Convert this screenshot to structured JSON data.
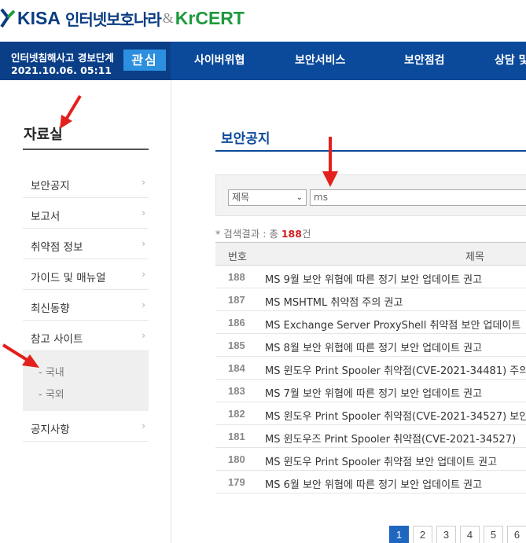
{
  "header": {
    "logo_kisa": "KISA",
    "logo_brand": "인터넷보호나라",
    "logo_amp": "&",
    "logo_krcert": "KrCERT"
  },
  "alert": {
    "title": "인터넷침해사고 경보단계",
    "date": "2021.10.06. 05:11",
    "level": "관심"
  },
  "nav": {
    "items": [
      "사이버위협",
      "보안서비스",
      "보안점검",
      "상담 및"
    ]
  },
  "sidebar": {
    "title": "자료실",
    "items": [
      {
        "label": "보안공지"
      },
      {
        "label": "보고서"
      },
      {
        "label": "취약점 정보"
      },
      {
        "label": "가이드 및 매뉴얼"
      },
      {
        "label": "최신동향"
      },
      {
        "label": "참고 사이트"
      }
    ],
    "sub_items": [
      "- 국내",
      "- 국외"
    ],
    "last_item": {
      "label": "공지사항"
    }
  },
  "main": {
    "title": "보안공지",
    "search": {
      "select_value": "제목",
      "input_value": "ms"
    },
    "result": {
      "prefix": "* 검색결과 : 총 ",
      "count": "188",
      "suffix": "건"
    },
    "table": {
      "columns": [
        "번호",
        "제목"
      ],
      "rows": [
        {
          "no": "188",
          "title": "MS 9월 보안 위협에 따른 정기 보안 업데이트 권고"
        },
        {
          "no": "187",
          "title": "MS MSHTML 취약점 주의 권고"
        },
        {
          "no": "186",
          "title": "MS Exchange Server ProxyShell 취약점 보안 업데이트"
        },
        {
          "no": "185",
          "title": "MS 8월 보안 위협에 따른 정기 보안 업데이트 권고"
        },
        {
          "no": "184",
          "title": "MS 윈도우 Print Spooler 취약점(CVE-2021-34481) 주의"
        },
        {
          "no": "183",
          "title": "MS 7월 보안 위협에 따른 정기 보안 업데이트 권고"
        },
        {
          "no": "182",
          "title": "MS 윈도우 Print Spooler 취약점(CVE-2021-34527) 보안"
        },
        {
          "no": "181",
          "title": "MS 윈도우즈 Print Spooler 취약점(CVE-2021-34527)"
        },
        {
          "no": "180",
          "title": "MS 윈도우 Print Spooler 취약점 보안 업데이트 권고"
        },
        {
          "no": "179",
          "title": "MS 6월 보안 위협에 따른 정기 보안 업데이트 권고"
        }
      ]
    },
    "pagination": [
      "1",
      "2",
      "3",
      "4",
      "5",
      "6"
    ],
    "active_page": "1"
  },
  "colors": {
    "nav_bg": "#0b4a9b",
    "alert_level_bg": "#2d8fe0",
    "accent_red": "#d21f1f",
    "annotation_arrow": "#e3201b"
  },
  "icons": {
    "chevron": "chevron-right-icon",
    "select_caret": "chevron-down-icon"
  }
}
